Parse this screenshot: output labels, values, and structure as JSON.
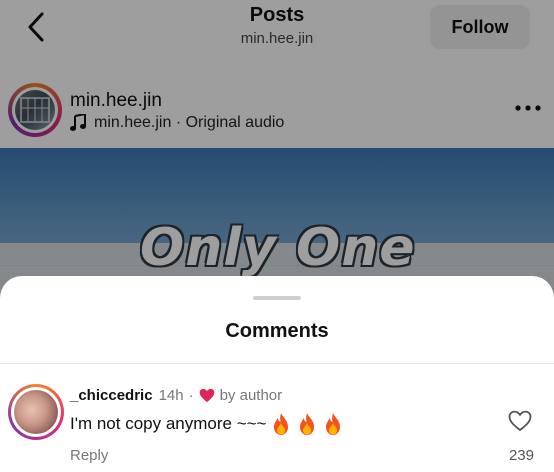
{
  "topbar": {
    "title": "Posts",
    "subtitle": "min.hee.jin",
    "follow_label": "Follow"
  },
  "post": {
    "username": "min.hee.jin",
    "audio": "min.hee.jin · Original audio",
    "image_text": "Only One"
  },
  "comments_sheet": {
    "title": "Comments",
    "comment": {
      "username": "_chiccedric",
      "time": "14h",
      "separator": "·",
      "liked_by": "by author",
      "text": "I'm not copy anymore ~~~",
      "reply_label": "Reply",
      "like_count": "239"
    }
  },
  "colors": {
    "heart": "#e0245e",
    "ring_start": "#f58529",
    "ring_mid": "#dd2a7b",
    "ring_end": "#8134af"
  },
  "icons": [
    "back-icon",
    "music-note-icon",
    "more-icon",
    "heart-filled-icon",
    "fire-icon",
    "heart-outline-icon"
  ]
}
